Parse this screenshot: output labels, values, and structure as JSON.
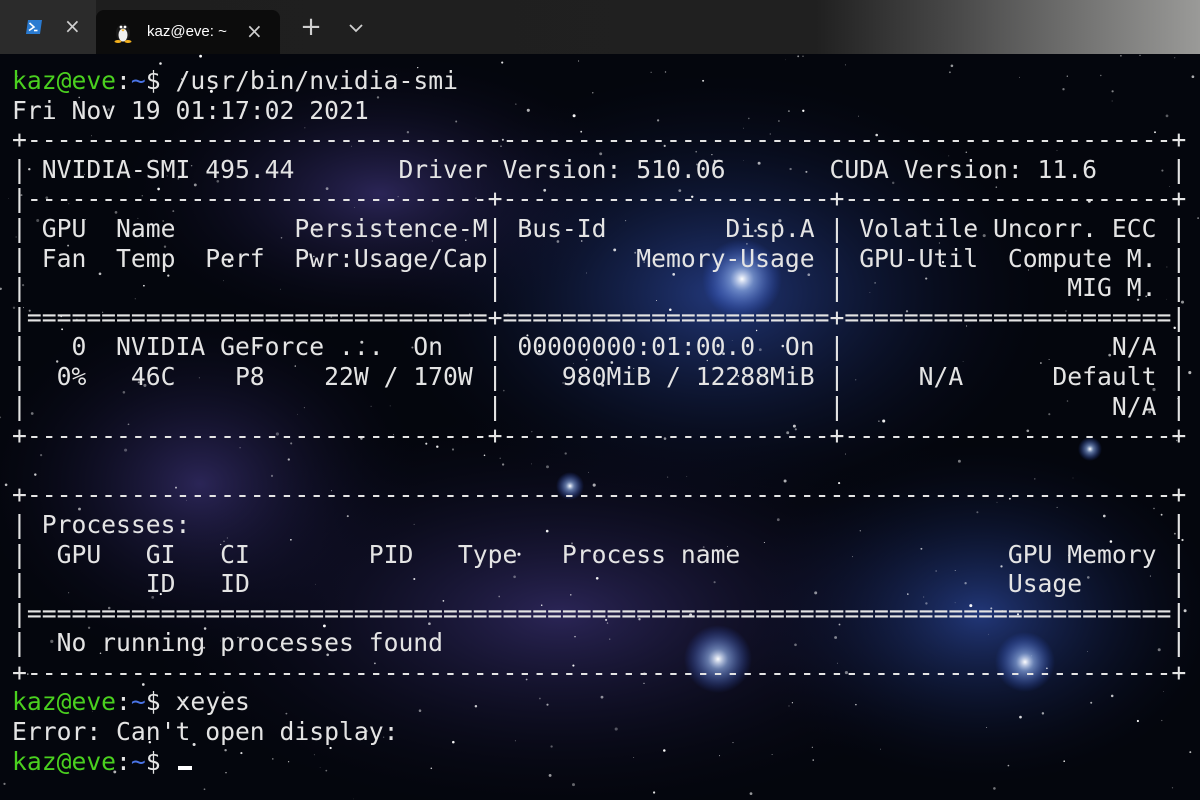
{
  "tabs": [
    {
      "title": "",
      "icon": "powershell-icon"
    },
    {
      "title": "kaz@eve: ~",
      "icon": "tux-icon"
    }
  ],
  "prompt": {
    "user_host": "kaz@eve",
    "colon": ":",
    "path": "~",
    "dollar": "$ "
  },
  "commands": {
    "first": "/usr/bin/nvidia-smi",
    "second": "xeyes",
    "third": ""
  },
  "output": [
    "Fri Nov 19 01:17:02 2021",
    "+-----------------------------------------------------------------------------+",
    "| NVIDIA-SMI 495.44       Driver Version: 510.06       CUDA Version: 11.6     |",
    "|-------------------------------+----------------------+----------------------+",
    "| GPU  Name        Persistence-M| Bus-Id        Disp.A | Volatile Uncorr. ECC |",
    "| Fan  Temp  Perf  Pwr:Usage/Cap|         Memory-Usage | GPU-Util  Compute M. |",
    "|                               |                      |               MIG M. |",
    "|===============================+======================+======================|",
    "|   0  NVIDIA GeForce ...  On   | 00000000:01:00.0  On |                  N/A |",
    "|  0%   46C    P8    22W / 170W |    980MiB / 12288MiB |     N/A      Default |",
    "|                               |                      |                  N/A |",
    "+-------------------------------+----------------------+----------------------+",
    "",
    "+-----------------------------------------------------------------------------+",
    "| Processes:                                                                  |",
    "|  GPU   GI   CI        PID   Type   Process name                  GPU Memory |",
    "|        ID   ID                                                   Usage      |",
    "|=============================================================================|",
    "|  No running processes found                                                 |",
    "+-----------------------------------------------------------------------------+"
  ],
  "error_line": "Error: Can't open display:",
  "colors": {
    "prompt_user": "#4ad01f",
    "prompt_path": "#4a74e6",
    "text": "#e4e4e4",
    "terminal_bg": "#05070f"
  }
}
